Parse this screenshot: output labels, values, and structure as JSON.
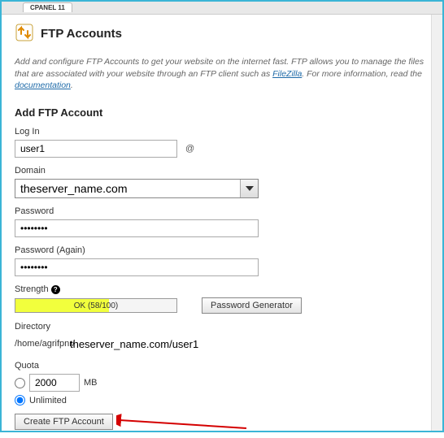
{
  "tab": {
    "label": "CPANEL 11"
  },
  "header": {
    "title": "FTP Accounts"
  },
  "intro": {
    "text_before": "Add and configure FTP Accounts to get your website on the internet fast. FTP allows you to manage the files that are associated with your website through an FTP client such as ",
    "filezilla": "FileZilla",
    "text_mid": ". For more information, read the ",
    "docs": "documentation",
    "text_after": "."
  },
  "form": {
    "section_title": "Add FTP Account",
    "login": {
      "label": "Log In",
      "value": "user1",
      "at": "@"
    },
    "domain": {
      "label": "Domain",
      "selected": "theserver_name.com"
    },
    "password": {
      "label": "Password",
      "value": "••••••••"
    },
    "password_again": {
      "label": "Password (Again)",
      "value": "••••••••"
    },
    "strength": {
      "label": "Strength",
      "text": "OK (58/100)",
      "fill_percent": 58,
      "generator_btn": "Password Generator"
    },
    "directory": {
      "label": "Directory",
      "prefix": "/home/agrifpnr/",
      "value": "theserver_name.com/user1"
    },
    "quota": {
      "label": "Quota",
      "value": "2000",
      "unit": "MB",
      "unlimited_label": "Unlimited",
      "selected": "unlimited"
    },
    "submit": "Create FTP Account"
  }
}
